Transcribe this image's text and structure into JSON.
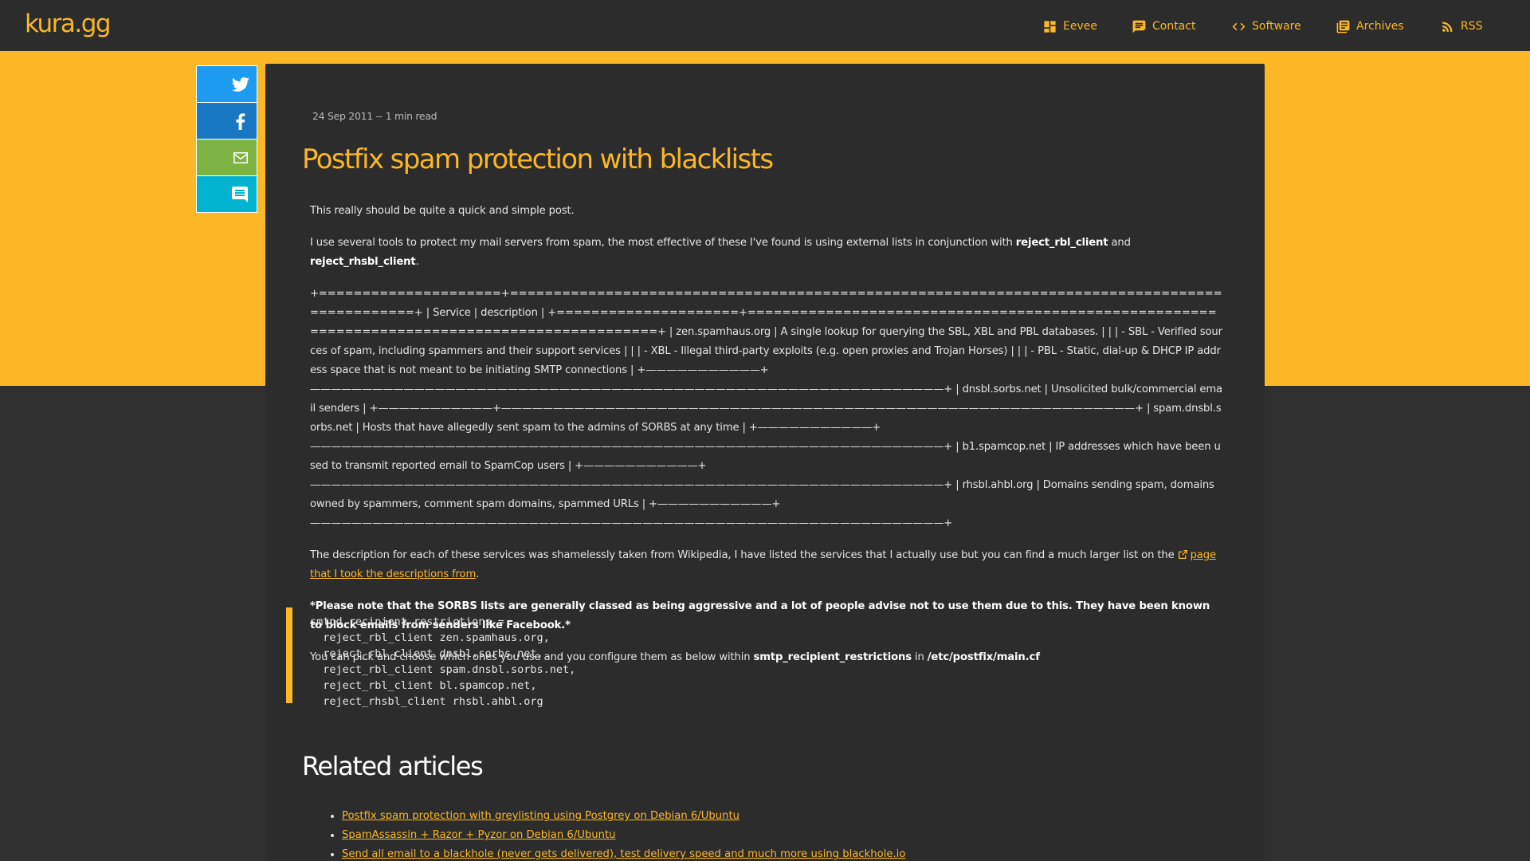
{
  "header": {
    "logo": "kura.gg",
    "nav": [
      {
        "label": "Eevee",
        "icon": "dashboard-icon"
      },
      {
        "label": "Contact",
        "icon": "chat-icon"
      },
      {
        "label": "Software",
        "icon": "code-icon"
      },
      {
        "label": "Archives",
        "icon": "archive-icon"
      },
      {
        "label": "RSS",
        "icon": "rss-icon"
      }
    ]
  },
  "share": [
    {
      "name": "twitter",
      "icon": "twitter-icon",
      "color": "#1d9bf0"
    },
    {
      "name": "facebook",
      "icon": "facebook-icon",
      "color": "#1877c2"
    },
    {
      "name": "email",
      "icon": "mail-icon",
      "color": "#7cb342"
    },
    {
      "name": "comments",
      "icon": "comment-icon",
      "color": "#00b4d0"
    }
  ],
  "article": {
    "meta": "24 Sep 2011 -- 1 min read",
    "title": "Postfix spam protection with blacklists",
    "p1": "This really should be quite a quick and simple post.",
    "p2_pre": "I use several tools to protect my mail servers from spam, the most effective of these I've found is using external lists in conjunction with ",
    "p2_b1": "reject_rbl_client",
    "p2_mid": " and ",
    "p2_b2": "reject_rhsbl_client",
    "p2_post": ".",
    "table_text": "+=====================+==============================================================================================+ | Service | description | +=====================+==============================================================================================+ | zen.spamhaus.org | A single lookup for querying the SBL, XBL and PBL databases. | | | - SBL - Verified sources of spam, including spammers and their support services | | | - XBL - Illegal third-party exploits (e.g. open proxies and Trojan Horses) | | | - PBL - Static, dial-up & DHCP IP address space that is not meant to be initiating SMTP connections | +———————————+—————————————————————————————————————————————————————————————+ | dnsbl.sorbs.net | Unsolicited bulk/commercial email senders | +———————————+—————————————————————————————————————————————————————————————+ | spam.dnsbl.sorbs.net | Hosts that have allegedly sent spam to the admins of SORBS at any time | +———————————+—————————————————————————————————————————————————————————————+ | b1.spamcop.net | IP addresses which have been used to transmit reported email to SpamCop users | +———————————+—————————————————————————————————————————————————————————————+ | rhsbl.ahbl.org | Domains sending spam, domains owned by spammers, comment spam domains, spammed URLs | +———————————+—————————————————————————————————————————————————————————————+",
    "p3_pre": "The description for each of these services was shamelessly taken from Wikipedia, I have listed the services that I actually use but you can find a much larger list on the ",
    "p3_link": "page that I took the descriptions from",
    "p3_post": ".",
    "p4": "*Please note that the SORBS lists are generally classed as being aggressive and a lot of people advise not to use them due to this. They have been known to block emails from senders like Facebook.*",
    "p5_pre": "You can pick and choose which ones you use and you configure them as below within ",
    "p5_b1": "smtp_recipient_restrictions",
    "p5_mid": " in ",
    "p5_b2": "/etc/postfix/main.cf",
    "code": "smtpd_recipient_restrictions =\n  reject_rbl_client zen.spamhaus.org,\n  reject_rbl_client dnsbl.sorbs.net,\n  reject_rbl_client spam.dnsbl.sorbs.net,\n  reject_rbl_client bl.spamcop.net,\n  reject_rhsbl_client rhsbl.ahbl.org",
    "related_title": "Related articles",
    "related": [
      "Postfix spam protection with greylisting using Postgrey on Debian 6/Ubuntu",
      "SpamAssassin + Razor + Pyzor on Debian 6/Ubuntu",
      "Send all email to a blackhole (never gets delivered), test delivery speed and much more using blackhole.io"
    ]
  },
  "colors": {
    "accent": "#fbb726",
    "background": "#303030",
    "card": "#2c2c2c"
  }
}
